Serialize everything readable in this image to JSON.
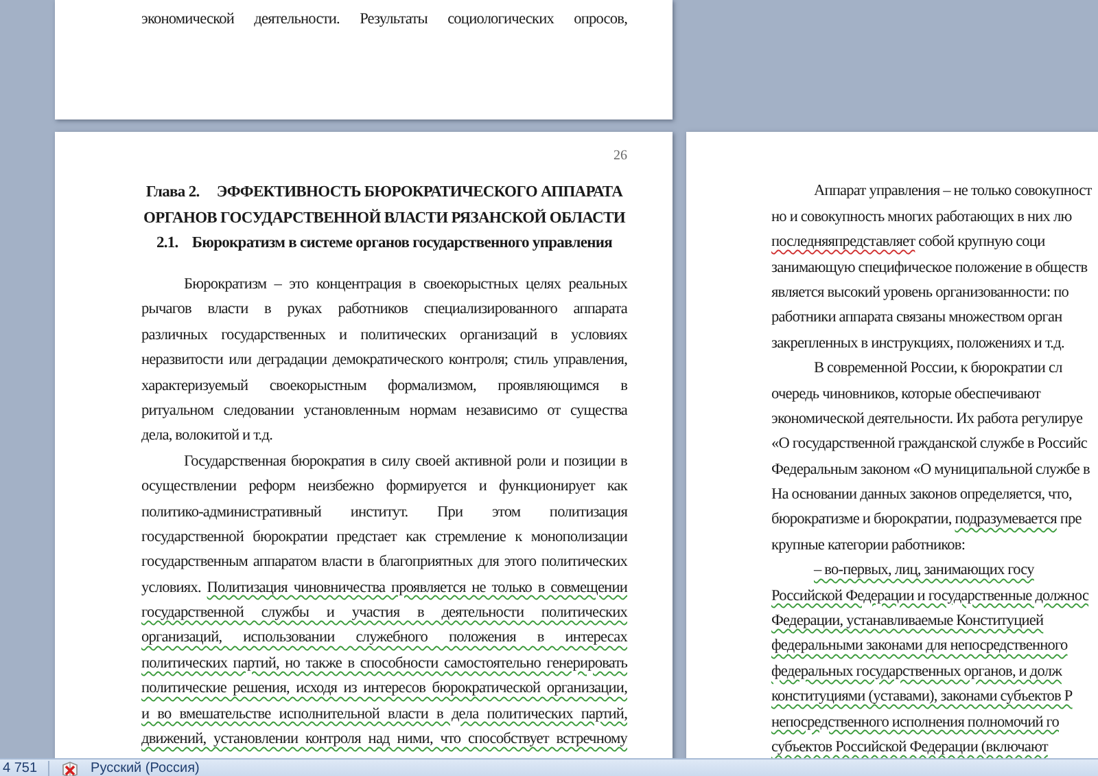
{
  "top_page": {
    "lines": [
      {
        "indent": false,
        "justified": true,
        "parts": [
          {
            "text": "экономической деятельности. Результаты социологических опросов,",
            "kind": "plain"
          }
        ]
      }
    ]
  },
  "left_page": {
    "page_number": "26",
    "chapter": {
      "number": "Глава 2.",
      "lines": [
        "ЭФФЕКТИВНОСТЬ БЮРОКРАТИЧЕСКОГО АППАРАТА",
        "ОРГАНОВ ГОСУДАРСТВЕННОЙ ВЛАСТИ РЯЗАНСКОЙ ОБЛАСТИ"
      ]
    },
    "section": {
      "number": "2.1.",
      "title": "Бюрократизм в системе органов государственного управления"
    },
    "lines": [
      {
        "indent": true,
        "justified": true,
        "parts": [
          {
            "text": "Бюрократизм – это концентрация в своекорыстных целях реальных",
            "kind": "plain"
          }
        ]
      },
      {
        "indent": false,
        "justified": true,
        "parts": [
          {
            "text": "рычагов власти в руках работников специализированного аппарата",
            "kind": "plain"
          }
        ]
      },
      {
        "indent": false,
        "justified": true,
        "parts": [
          {
            "text": "различных государственных и политических организаций в условиях",
            "kind": "plain"
          }
        ]
      },
      {
        "indent": false,
        "justified": true,
        "parts": [
          {
            "text": "неразвитости или деградации демократического контроля; стиль управления,",
            "kind": "plain"
          }
        ]
      },
      {
        "indent": false,
        "justified": true,
        "parts": [
          {
            "text": "характеризуемый своекорыстным формализмом, проявляющимся в",
            "kind": "plain"
          }
        ]
      },
      {
        "indent": false,
        "justified": true,
        "parts": [
          {
            "text": "ритуальном следовании установленным нормам независимо от существа",
            "kind": "plain"
          }
        ]
      },
      {
        "indent": false,
        "justified": false,
        "parts": [
          {
            "text": "дела, волокитой и т.д.",
            "kind": "plain"
          }
        ]
      },
      {
        "indent": true,
        "justified": true,
        "parts": [
          {
            "text": "Государственная бюрократия в силу своей активной роли и позиции в",
            "kind": "plain"
          }
        ]
      },
      {
        "indent": false,
        "justified": true,
        "parts": [
          {
            "text": "осуществлении реформ неизбежно формируется и функционирует как",
            "kind": "plain"
          }
        ]
      },
      {
        "indent": false,
        "justified": true,
        "parts": [
          {
            "text": "политико-административный институт. При этом политизация",
            "kind": "plain"
          }
        ]
      },
      {
        "indent": false,
        "justified": true,
        "parts": [
          {
            "text": "государственной бюрократии предстает как стремление к монополизации",
            "kind": "plain"
          }
        ]
      },
      {
        "indent": false,
        "justified": true,
        "parts": [
          {
            "text": "государственным аппаратом власти в благоприятных для этого политических",
            "kind": "plain"
          }
        ]
      },
      {
        "indent": false,
        "justified": true,
        "parts": [
          {
            "text": "условиях. ",
            "kind": "plain"
          },
          {
            "text": "Политизация чиновничества проявляется не только в совмещении",
            "kind": "grammar_error"
          }
        ]
      },
      {
        "indent": false,
        "justified": true,
        "parts": [
          {
            "text": "государственной службы и участия в деятельности политических",
            "kind": "grammar_error"
          }
        ]
      },
      {
        "indent": false,
        "justified": true,
        "parts": [
          {
            "text": "организаций, использовании служебного положения в интересах",
            "kind": "grammar_error"
          }
        ]
      },
      {
        "indent": false,
        "justified": true,
        "parts": [
          {
            "text": "политических партий, но также в способности самостоятельно генерировать",
            "kind": "grammar_error"
          }
        ]
      },
      {
        "indent": false,
        "justified": true,
        "parts": [
          {
            "text": "политические решения, исходя из интересов бюрократической организации,",
            "kind": "grammar_error"
          }
        ]
      },
      {
        "indent": false,
        "justified": true,
        "parts": [
          {
            "text": "и во вмешательстве исполнительной власти в дела политических партий,",
            "kind": "grammar_error"
          }
        ]
      },
      {
        "indent": false,
        "justified": true,
        "parts": [
          {
            "text": "движений, установлении контроля над ними, что способствует встречному",
            "kind": "grammar_error"
          }
        ]
      }
    ]
  },
  "right_page": {
    "lines": [
      {
        "indent": true,
        "justified": false,
        "parts": [
          {
            "text": "Аппарат управления – не только совокупност",
            "kind": "plain"
          }
        ]
      },
      {
        "indent": false,
        "justified": false,
        "parts": [
          {
            "text": "но и совокупность многих работающих в них лю",
            "kind": "plain"
          }
        ]
      },
      {
        "indent": false,
        "justified": false,
        "parts": [
          {
            "text": "последняяпредставляет",
            "kind": "spelling_error"
          },
          {
            "text": " собой крупную соци",
            "kind": "plain"
          }
        ]
      },
      {
        "indent": false,
        "justified": false,
        "parts": [
          {
            "text": "занимающую специфическое положение в обществ",
            "kind": "plain"
          }
        ]
      },
      {
        "indent": false,
        "justified": false,
        "parts": [
          {
            "text": "является высокий уровень организованности: по",
            "kind": "plain"
          }
        ]
      },
      {
        "indent": false,
        "justified": false,
        "parts": [
          {
            "text": "работники аппарата связаны множеством орган",
            "kind": "plain"
          }
        ]
      },
      {
        "indent": false,
        "justified": false,
        "parts": [
          {
            "text": "закрепленных в инструкциях, положениях и т.д.",
            "kind": "plain"
          }
        ]
      },
      {
        "indent": true,
        "justified": false,
        "parts": [
          {
            "text": "В современной России, к бюрократии сл",
            "kind": "plain"
          }
        ]
      },
      {
        "indent": false,
        "justified": false,
        "parts": [
          {
            "text": "очередь чиновников, которые обеспечивают",
            "kind": "plain"
          }
        ]
      },
      {
        "indent": false,
        "justified": false,
        "parts": [
          {
            "text": "экономической деятельности. Их работа регулируе",
            "kind": "plain"
          }
        ]
      },
      {
        "indent": false,
        "justified": false,
        "parts": [
          {
            "text": "«О государственной гражданской службе в Российс",
            "kind": "plain"
          }
        ]
      },
      {
        "indent": false,
        "justified": false,
        "parts": [
          {
            "text": "Федеральным законом «О муниципальной службе в",
            "kind": "plain"
          }
        ]
      },
      {
        "indent": false,
        "justified": false,
        "parts": [
          {
            "text": "На основании данных законов определяется, что,",
            "kind": "plain"
          }
        ]
      },
      {
        "indent": false,
        "justified": false,
        "parts": [
          {
            "text": "бюрократизме и бюрократии, ",
            "kind": "plain"
          },
          {
            "text": "подразумевается",
            "kind": "grammar_error"
          },
          {
            "text": " пре",
            "kind": "plain"
          }
        ]
      },
      {
        "indent": false,
        "justified": false,
        "parts": [
          {
            "text": "крупные категории работников:",
            "kind": "plain"
          }
        ]
      },
      {
        "indent": true,
        "justified": false,
        "parts": [
          {
            "text": "–      во-первых, лиц, занимающих госу",
            "kind": "grammar_error"
          }
        ]
      },
      {
        "indent": false,
        "justified": false,
        "parts": [
          {
            "text": "Российской Федерации и государственные должнос",
            "kind": "grammar_error"
          }
        ]
      },
      {
        "indent": false,
        "justified": false,
        "parts": [
          {
            "text": "Федерации, устанавливаемые Конституцией",
            "kind": "grammar_error"
          }
        ]
      },
      {
        "indent": false,
        "justified": false,
        "parts": [
          {
            "text": "федеральными законами для непосредственного",
            "kind": "grammar_error"
          }
        ]
      },
      {
        "indent": false,
        "justified": false,
        "parts": [
          {
            "text": "федеральных государственных органов, и долж",
            "kind": "grammar_error"
          }
        ]
      },
      {
        "indent": false,
        "justified": false,
        "parts": [
          {
            "text": "конституциями (уставами), законами субъектов Р",
            "kind": "grammar_error"
          }
        ]
      },
      {
        "indent": false,
        "justified": false,
        "parts": [
          {
            "text": "непосредственного исполнения полномочий го",
            "kind": "grammar_error"
          }
        ]
      },
      {
        "indent": false,
        "justified": false,
        "parts": [
          {
            "text": "субъектов Российской Федерации (включают",
            "kind": "grammar_error"
          }
        ]
      }
    ]
  },
  "status_bar": {
    "word_count": "4 751",
    "language": "Русский (Россия)"
  }
}
